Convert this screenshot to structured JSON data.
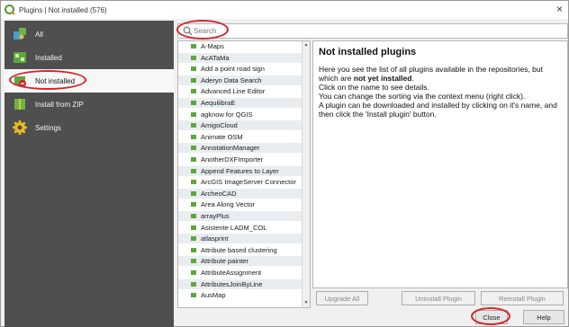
{
  "window": {
    "title": "Plugins | Not installed (576)",
    "close_glyph": "×",
    "app_icon": "qgis-logo-icon"
  },
  "sidebar": {
    "items": [
      {
        "label": "All",
        "icon": "puzzle-icon"
      },
      {
        "label": "Installed",
        "icon": "installed-plugins-icon"
      },
      {
        "label": "Not installed",
        "icon": "not-installed-plugins-icon"
      },
      {
        "label": "Install from ZIP",
        "icon": "zip-install-icon"
      },
      {
        "label": "Settings",
        "icon": "gear-icon"
      }
    ],
    "active_index": 2
  },
  "search": {
    "placeholder": "Search",
    "value": ""
  },
  "plugins": [
    "A-Maps",
    "AcATaMa",
    "Add a point road sign",
    "Aderyn Data Search",
    "Advanced Line Editor",
    "AequilibraE",
    "agknow for QGIS",
    "AmigoCloud",
    "Animate OSM",
    "AnnotationManager",
    "AnotherDXFImporter",
    "Append Features to Layer",
    "ArcGIS ImageServer Connector",
    "ArcheoCAD",
    "Area Along Vector",
    "arrayPlus",
    "Asistente LADM_COL",
    "atlasprint",
    "Attribute based clustering",
    "Attribute painter",
    "AttributeAssignment",
    "AttributesJoinByLine",
    "AusMap"
  ],
  "details": {
    "heading": "Not installed plugins",
    "para1_a": "Here you see the list of all plugins available in the repositories, but which are ",
    "para1_b": "not yet installed",
    "para1_c": ".",
    "para2": "Click on the name to see details.",
    "para3": "You can change the sorting via the context menu (right click).",
    "para4": "A plugin can be downloaded and installed by clicking on it's name, and then click the 'Install plugin' button."
  },
  "buttons": {
    "upgrade_all": "Upgrade All",
    "uninstall": "Uninstall Plugin",
    "reinstall": "Reinstall Plugin",
    "close": "Close",
    "help": "Help"
  },
  "colors": {
    "sidebar_bg": "#4f4f4f",
    "annotation_red": "#d4242a",
    "plugin_icon_green": "#5aa83c"
  }
}
